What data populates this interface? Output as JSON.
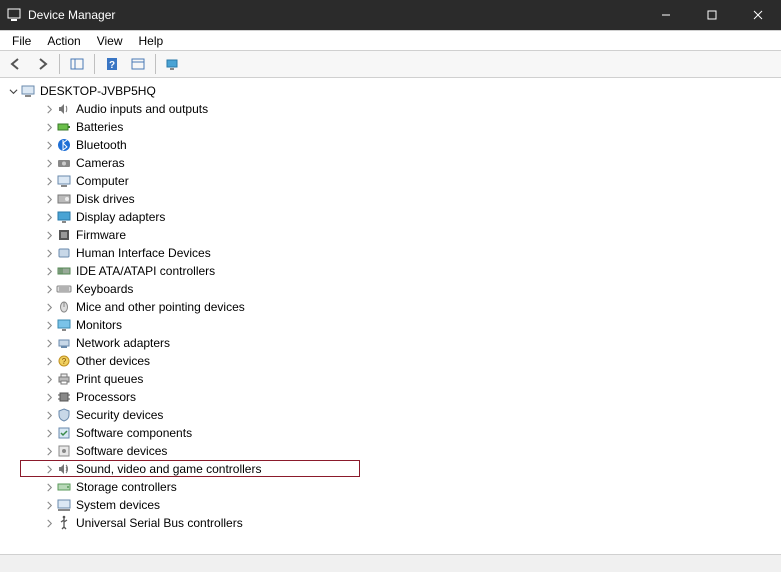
{
  "window": {
    "title": "Device Manager"
  },
  "menu": {
    "file": "File",
    "action": "Action",
    "view": "View",
    "help": "Help"
  },
  "root": {
    "name": "DESKTOP-JVBP5HQ"
  },
  "categories": [
    {
      "label": "Audio inputs and outputs",
      "icon": "speaker"
    },
    {
      "label": "Batteries",
      "icon": "battery"
    },
    {
      "label": "Bluetooth",
      "icon": "bluetooth"
    },
    {
      "label": "Cameras",
      "icon": "camera"
    },
    {
      "label": "Computer",
      "icon": "computer"
    },
    {
      "label": "Disk drives",
      "icon": "disk"
    },
    {
      "label": "Display adapters",
      "icon": "display"
    },
    {
      "label": "Firmware",
      "icon": "firmware"
    },
    {
      "label": "Human Interface Devices",
      "icon": "hid"
    },
    {
      "label": "IDE ATA/ATAPI controllers",
      "icon": "ide"
    },
    {
      "label": "Keyboards",
      "icon": "keyboard"
    },
    {
      "label": "Mice and other pointing devices",
      "icon": "mouse"
    },
    {
      "label": "Monitors",
      "icon": "monitor"
    },
    {
      "label": "Network adapters",
      "icon": "network"
    },
    {
      "label": "Other devices",
      "icon": "other"
    },
    {
      "label": "Print queues",
      "icon": "printer"
    },
    {
      "label": "Processors",
      "icon": "cpu"
    },
    {
      "label": "Security devices",
      "icon": "security"
    },
    {
      "label": "Software components",
      "icon": "swcomp"
    },
    {
      "label": "Software devices",
      "icon": "swdev"
    },
    {
      "label": "Sound, video and game controllers",
      "icon": "sound",
      "highlighted": true
    },
    {
      "label": "Storage controllers",
      "icon": "storage"
    },
    {
      "label": "System devices",
      "icon": "system"
    },
    {
      "label": "Universal Serial Bus controllers",
      "icon": "usb"
    }
  ],
  "colors": {
    "highlight_border": "#8b1a2b",
    "titlebar": "#2b2b2b"
  }
}
